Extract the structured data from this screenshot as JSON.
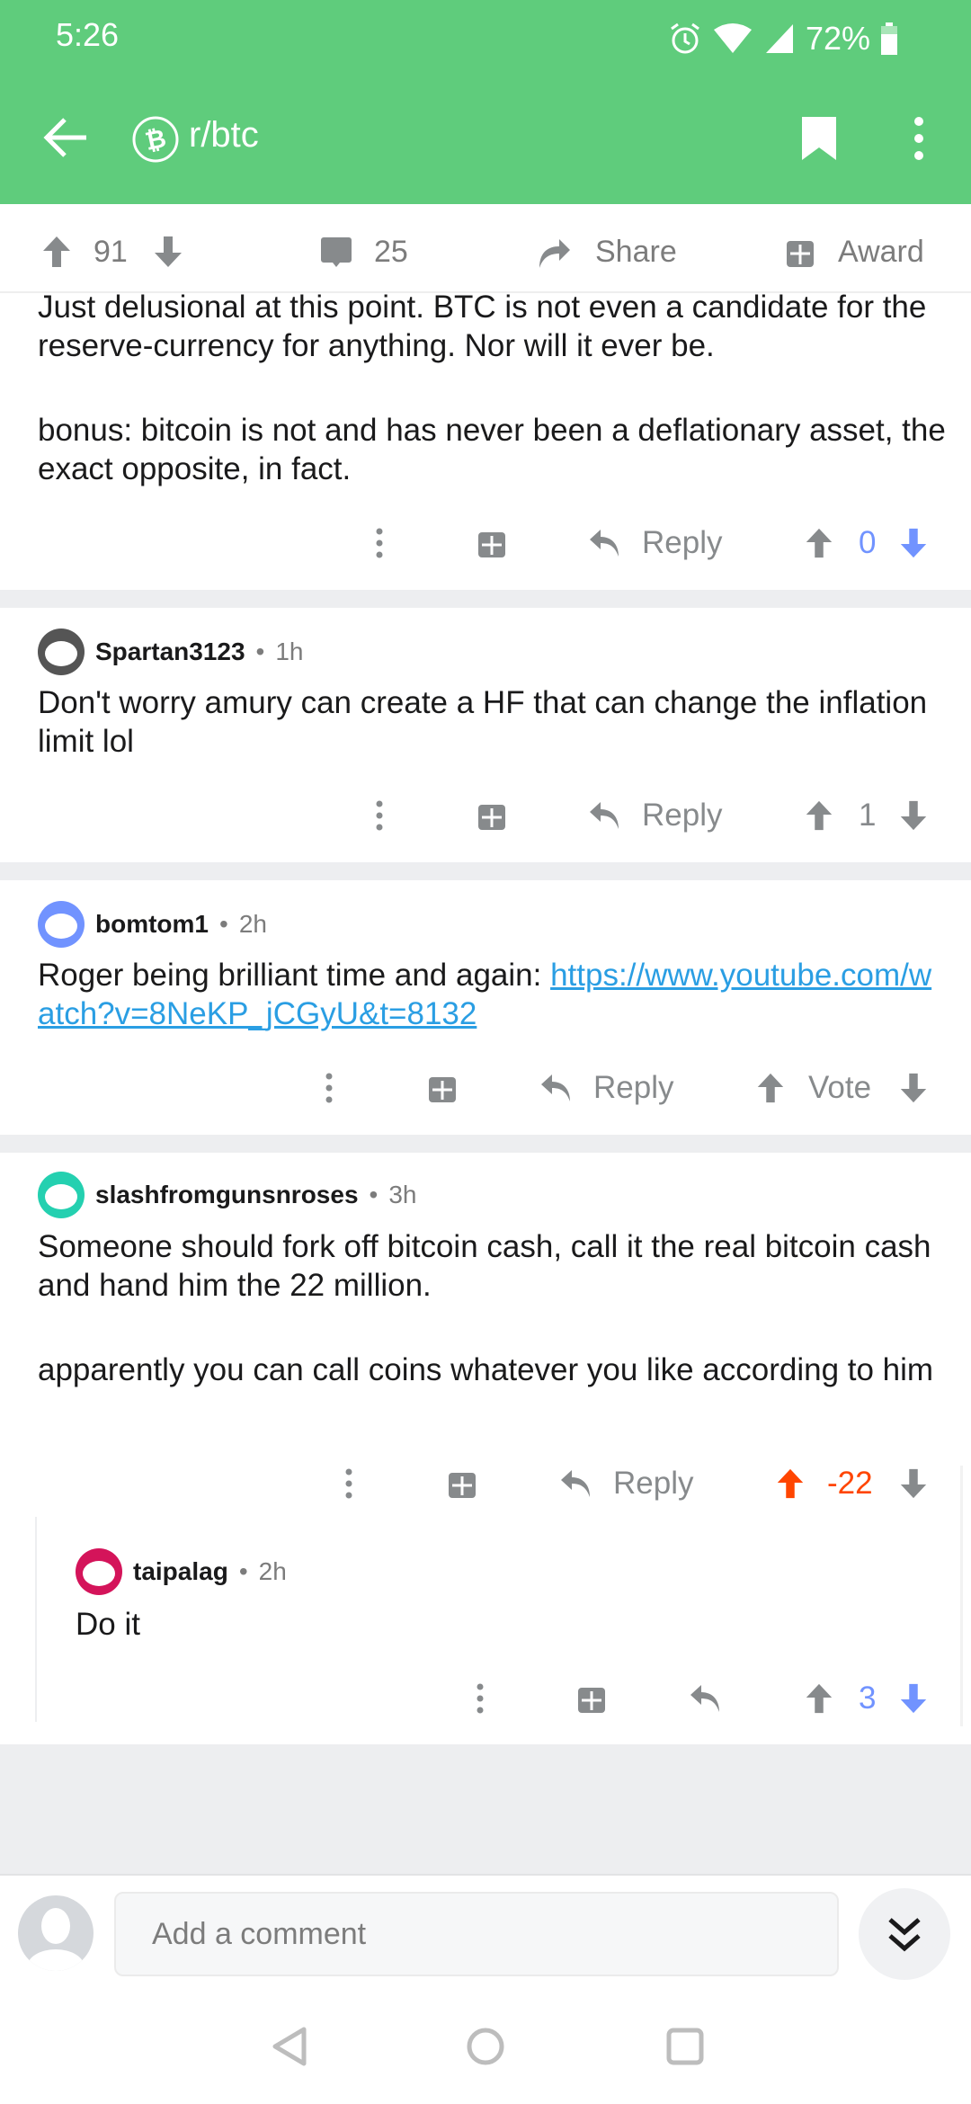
{
  "status_bar": {
    "time": "5:26",
    "battery": "72%"
  },
  "toolbar": {
    "subreddit": "r/btc"
  },
  "post_actions": {
    "score": "91",
    "comments": "25",
    "share": "Share",
    "award": "Award"
  },
  "comments": [
    {
      "paragraphs": [
        "Just delusional at this point. BTC is not even a candidate for the reserve-currency for anything. Nor will it ever be.",
        "bonus: bitcoin is not and has never been a deflationary asset, the exact opposite, in fact."
      ],
      "reply": "Reply",
      "score": "0"
    },
    {
      "author": "Spartan3123",
      "time": "1h",
      "paragraphs": [
        "Don't worry amury can create a HF that can change the inflation limit lol"
      ],
      "reply": "Reply",
      "score": "1"
    },
    {
      "author": "bomtom1",
      "time": "2h",
      "text": "Roger being brilliant time and again: ",
      "link": "https://www.youtube.com/watch?v=8NeKP_jCGyU&t=8132",
      "reply": "Reply",
      "score": "Vote"
    },
    {
      "author": "slashfromgunsnroses",
      "time": "3h",
      "paragraphs": [
        "Someone should fork off bitcoin cash, call it the real bitcoin cash and hand him the 22 million.",
        "apparently you can call coins whatever you like according to him"
      ],
      "reply": "Reply",
      "score": "-22"
    },
    {
      "author": "taipalag",
      "time": "2h",
      "paragraphs": [
        "Do it"
      ],
      "score": "3"
    }
  ],
  "comment_bar": {
    "placeholder": "Add a comment"
  },
  "colors": {
    "header": "#5fcc7c",
    "upvote": "#ff4500",
    "downvote": "#7193ff",
    "link": "#2a9ee3"
  }
}
